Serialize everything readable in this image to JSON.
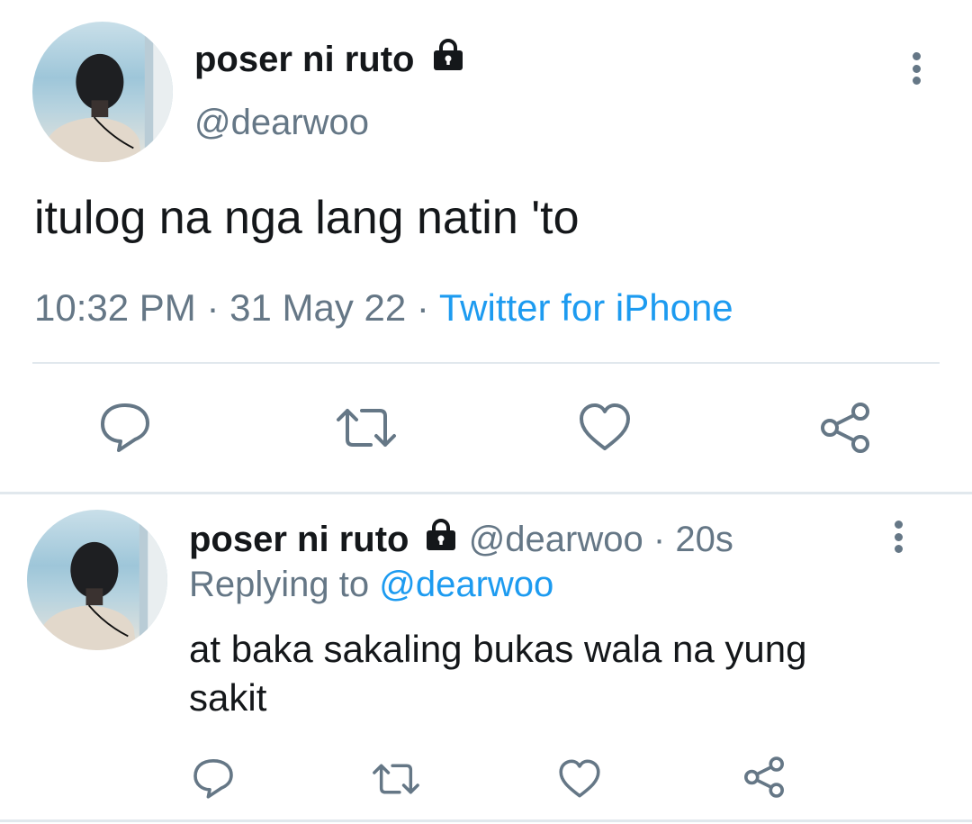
{
  "main_tweet": {
    "author_name": "poser ni ruto",
    "handle": "@dearwoo",
    "text": "itulog na nga lang natin 'to",
    "time": "10:32 PM",
    "date": "31 May 22",
    "separator": "·",
    "source": "Twitter for iPhone",
    "icons": {
      "lock": "lock-icon",
      "more": "more-vertical-icon"
    },
    "actions": [
      "reply-icon",
      "retweet-icon",
      "like-icon",
      "share-icon"
    ]
  },
  "reply_tweet": {
    "author_name": "poser ni ruto",
    "handle": "@dearwoo",
    "separator": "·",
    "relative_time": "20s",
    "replying_label": "Replying to",
    "replying_handle": "@dearwoo",
    "text_line1": "at baka sakaling bukas wala na yung",
    "text_line2": "sakit",
    "icons": {
      "lock": "lock-icon",
      "more": "more-vertical-icon"
    },
    "actions": [
      "reply-icon",
      "retweet-icon",
      "like-icon",
      "share-icon"
    ]
  },
  "colors": {
    "text": "#14171a",
    "secondary": "#657786",
    "link": "#1d9bf0",
    "divider": "#e1e8ed"
  }
}
